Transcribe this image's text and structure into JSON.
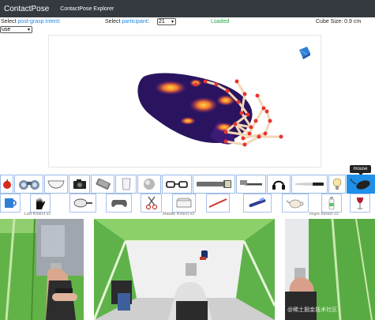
{
  "navbar": {
    "brand": "ContactPose",
    "link": "ContactPose Explorer"
  },
  "controls": {
    "intent_prefix": "Select ",
    "intent_highlight": "post-grasp intent",
    "intent_suffix": ":",
    "intent_value": "use",
    "participant_prefix": "Select ",
    "participant_highlight": "participant",
    "participant_suffix": ":",
    "participant_value": "21",
    "status": "Loaded",
    "cube_size": "Cube Size: 0.9 cm"
  },
  "tooltip": "mouse",
  "objects_row1": [
    "apple",
    "binoculars",
    "bowl",
    "camera",
    "cell-phone",
    "cup",
    "door-knob",
    "eyeglasses",
    "flashlight",
    "hammer",
    "headphones",
    "knife",
    "light-bulb",
    "mouse"
  ],
  "objects_row2": [
    "mug",
    "palm-print",
    "pan",
    "game-controller",
    "scissors",
    "speaker",
    "stapler",
    "toothbrush",
    "toothpaste",
    "teapot",
    "water-bottle",
    "wine-glass"
  ],
  "selected_object": "mouse",
  "camera_labels": {
    "left": "Left Kinect v2",
    "middle": "Middle Kinect v2",
    "right": "Right Kinect v2"
  },
  "watermark": "@稀土掘金技术社区",
  "colors": {
    "navbar": "#343a40",
    "accent": "#1e88e5",
    "loaded": "#28a745",
    "selected": "#1f8fe8"
  }
}
